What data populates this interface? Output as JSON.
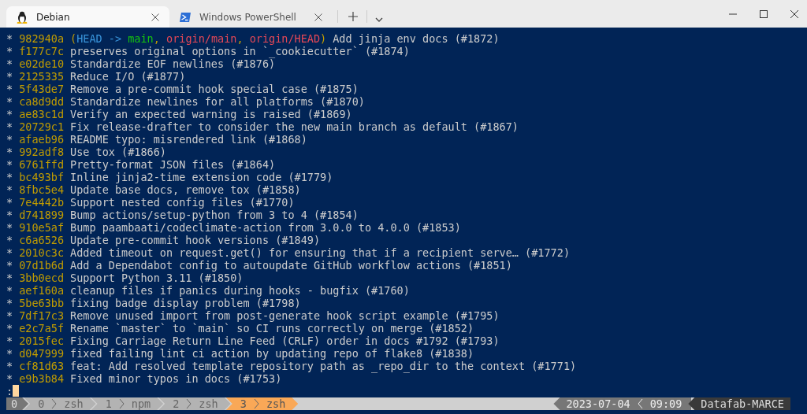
{
  "tabs": [
    {
      "title": "Debian",
      "kind": "linux",
      "selected": true
    },
    {
      "title": "Windows PowerShell",
      "kind": "shell",
      "selected": false
    }
  ],
  "log": [
    {
      "graph": "*",
      "hash": "982940a",
      "decoration": [
        {
          "text": "(",
          "kind": "paren"
        },
        {
          "text": "HEAD ->",
          "kind": "head"
        },
        {
          "text": "main",
          "kind": "local"
        },
        {
          "text": ", ",
          "kind": "paren"
        },
        {
          "text": "origin/main",
          "kind": "remote"
        },
        {
          "text": ", ",
          "kind": "paren"
        },
        {
          "text": "origin/HEAD",
          "kind": "remote"
        },
        {
          "text": ")",
          "kind": "paren"
        }
      ],
      "message": "Add jinja env docs (#1872)"
    },
    {
      "graph": "*",
      "hash": "f177c7c",
      "message": "preserves original options in `_cookiecutter` (#1874)"
    },
    {
      "graph": "*",
      "hash": "e02de10",
      "message": "Standardize EOF newlines (#1876)"
    },
    {
      "graph": "*",
      "hash": "2125335",
      "message": "Reduce I/O (#1877)"
    },
    {
      "graph": "*",
      "hash": "5f43de7",
      "message": "Remove a pre-commit hook special case (#1875)"
    },
    {
      "graph": "*",
      "hash": "ca8d9dd",
      "message": "Standardize newlines for all platforms (#1870)"
    },
    {
      "graph": "*",
      "hash": "ae83c1d",
      "message": "Verify an expected warning is raised (#1869)"
    },
    {
      "graph": "*",
      "hash": "20729c1",
      "message": "Fix release-drafter to consider the new main branch as default (#1867)"
    },
    {
      "graph": "*",
      "hash": "afaeb96",
      "message": "README typo: misrendered link (#1868)"
    },
    {
      "graph": "*",
      "hash": "992adf8",
      "message": "Use tox (#1866)"
    },
    {
      "graph": "*",
      "hash": "6761ffd",
      "message": "Pretty-format JSON files (#1864)"
    },
    {
      "graph": "*",
      "hash": "bc493bf",
      "message": "Inline jinja2-time extension code (#1779)"
    },
    {
      "graph": "*",
      "hash": "8fbc5e4",
      "message": "Update base docs, remove tox (#1858)"
    },
    {
      "graph": "*",
      "hash": "7e4442b",
      "message": "Support nested config files (#1770)"
    },
    {
      "graph": "*",
      "hash": "d741899",
      "message": "Bump actions/setup-python from 3 to 4 (#1854)"
    },
    {
      "graph": "*",
      "hash": "910e5af",
      "message": "Bump paambaati/codeclimate-action from 3.0.0 to 4.0.0 (#1853)"
    },
    {
      "graph": "*",
      "hash": "c6a6526",
      "message": "Update pre-commit hook versions (#1849)"
    },
    {
      "graph": "*",
      "hash": "2010c3c",
      "message": "Added timeout on request.get() for ensuring that if a recipient serve… (#1772)"
    },
    {
      "graph": "*",
      "hash": "07d1b6d",
      "message": "Add a Dependabot config to autoupdate GitHub workflow actions (#1851)"
    },
    {
      "graph": "*",
      "hash": "3bb0ecd",
      "message": "Support Python 3.11 (#1850)"
    },
    {
      "graph": "*",
      "hash": "aef160a",
      "message": "cleanup files if panics during hooks - bugfix (#1760)"
    },
    {
      "graph": "*",
      "hash": "5be63bb",
      "message": "fixing badge display problem (#1798)"
    },
    {
      "graph": "*",
      "hash": "7df17c3",
      "message": "Remove unused import from post-generate hook script example (#1795)"
    },
    {
      "graph": "*",
      "hash": "e2c7a5f",
      "message": "Rename `master` to `main` so CI runs correctly on merge (#1852)"
    },
    {
      "graph": "*",
      "hash": "2015fec",
      "message": "Fixing Carriage Return Line Feed (CRLF) order in docs #1792 (#1793)"
    },
    {
      "graph": "*",
      "hash": "d047999",
      "message": "fixed failing lint ci action by updating repo of flake8 (#1838)"
    },
    {
      "graph": "*",
      "hash": "cf81d63",
      "message": "feat: Add resolved template repository path as _repo_dir to the context (#1771)"
    },
    {
      "graph": "*",
      "hash": "e9b3b84",
      "message": "Fixed minor typos in docs (#1753)"
    }
  ],
  "pager_prompt": ":",
  "status_bar": {
    "session": "0",
    "windows": [
      {
        "index": "0",
        "name": "zsh",
        "selected": false
      },
      {
        "index": "1",
        "name": "npm",
        "selected": false
      },
      {
        "index": "2",
        "name": "zsh",
        "selected": false
      },
      {
        "index": "3",
        "name": "zsh",
        "selected": true
      }
    ],
    "date": "2023-07-04",
    "time": "09:09",
    "host": "Datafab-MARCE"
  }
}
